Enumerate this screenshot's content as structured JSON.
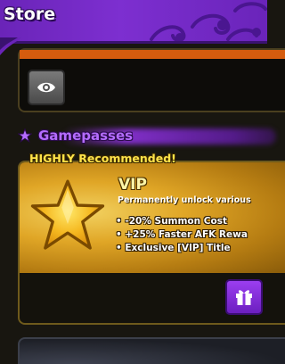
{
  "header": {
    "title": "Store"
  },
  "top_panel": {
    "view_icon": "eye-icon"
  },
  "gamepasses": {
    "section_icon": "star-icon",
    "section_title": "Gamepasses",
    "vip": {
      "badge": "HIGHLY Recommended!",
      "icon": "gold-star-icon",
      "title": "VIP",
      "subtitle": "Permanently unlock various",
      "perks": [
        "• -20% Summon Cost",
        "• +25% Faster AFK Rewa",
        "• Exclusive [VIP] Title"
      ],
      "gift_icon": "gift-icon"
    }
  },
  "colors": {
    "header_purple": "#7d2fd0",
    "accent_orange": "#d55c0e",
    "gold": "#e0a626",
    "badge_yellow": "#ffe34a",
    "section_purple": "#b46cff",
    "gift_button": "#8a35e0"
  }
}
